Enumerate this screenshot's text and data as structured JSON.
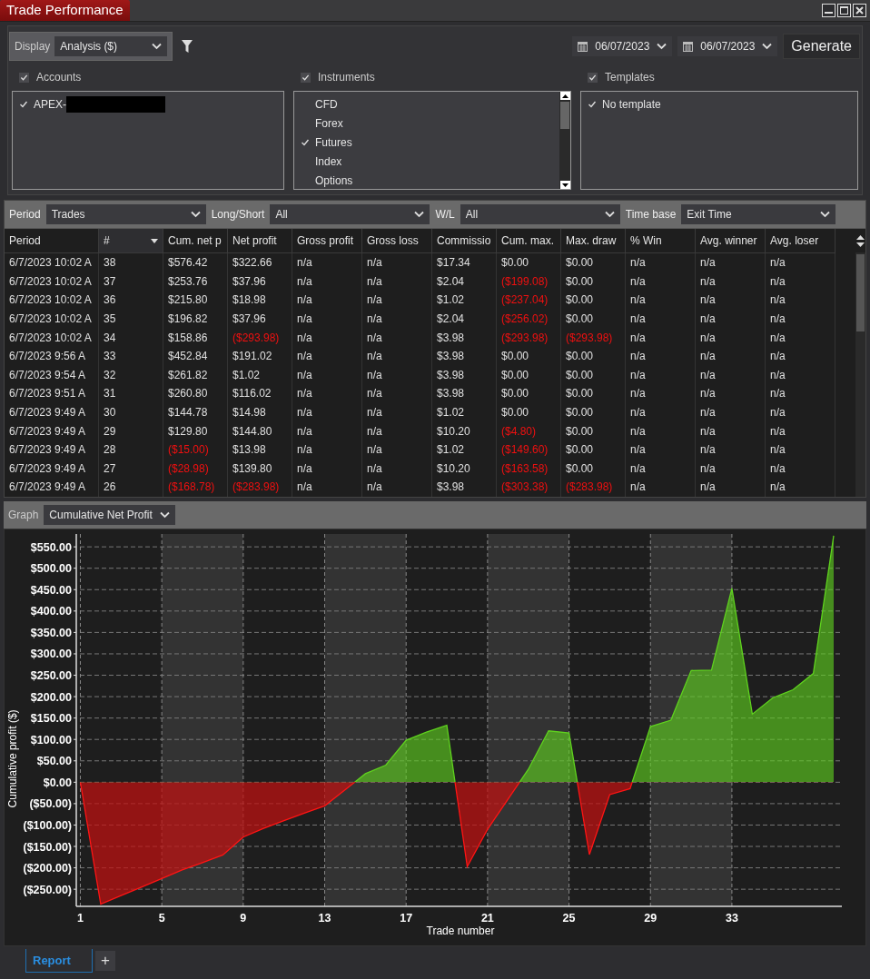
{
  "window": {
    "title": "Trade Performance"
  },
  "toolbar": {
    "display_label": "Display",
    "display_value": "Analysis ($)",
    "from_date": "06/07/2023",
    "to_date": "06/07/2023",
    "generate": "Generate"
  },
  "filters": [
    {
      "label": "Accounts",
      "checked": true,
      "kind": "plain",
      "items": [
        {
          "label": "APEX-",
          "checked": true,
          "redacted": true
        }
      ]
    },
    {
      "label": "Instruments",
      "checked": true,
      "kind": "scroll",
      "items": [
        {
          "label": "CFD",
          "checked": false,
          "redacted": false
        },
        {
          "label": "Forex",
          "checked": false,
          "redacted": false
        },
        {
          "label": "Futures",
          "checked": true,
          "redacted": false
        },
        {
          "label": "Index",
          "checked": false,
          "redacted": false
        },
        {
          "label": "Options",
          "checked": false,
          "redacted": false
        }
      ]
    },
    {
      "label": "Templates",
      "checked": true,
      "kind": "plain",
      "items": [
        {
          "label": "No template",
          "checked": true,
          "redacted": false
        }
      ]
    }
  ],
  "report": {
    "filters": [
      {
        "label": "Period",
        "value": "Trades"
      },
      {
        "label": "Long/Short",
        "value": "All"
      },
      {
        "label": "W/L",
        "value": "All"
      },
      {
        "label": "Time base",
        "value": "Exit Time"
      }
    ],
    "columns": [
      {
        "label": "Period",
        "sorted": false
      },
      {
        "label": "#",
        "sorted": true
      },
      {
        "label": "Cum. net p",
        "sorted": false
      },
      {
        "label": "Net profit",
        "sorted": false
      },
      {
        "label": "Gross profit",
        "sorted": false
      },
      {
        "label": "Gross loss",
        "sorted": false
      },
      {
        "label": "Commissio",
        "sorted": false
      },
      {
        "label": "Cum. max.",
        "sorted": false
      },
      {
        "label": "Max. draw",
        "sorted": false
      },
      {
        "label": "% Win",
        "sorted": false
      },
      {
        "label": "Avg. winner",
        "sorted": false
      },
      {
        "label": "Avg. loser",
        "sorted": false
      }
    ],
    "rows": [
      [
        "6/7/2023 10:02 A",
        "38",
        "$576.42",
        "$322.66",
        "n/a",
        "n/a",
        "$17.34",
        "$0.00",
        "$0.00",
        "n/a",
        "n/a",
        "n/a"
      ],
      [
        "6/7/2023 10:02 A",
        "37",
        "$253.76",
        "$37.96",
        "n/a",
        "n/a",
        "$2.04",
        {
          "text": "($199.08)",
          "negative": true
        },
        "$0.00",
        "n/a",
        "n/a",
        "n/a"
      ],
      [
        "6/7/2023 10:02 A",
        "36",
        "$215.80",
        "$18.98",
        "n/a",
        "n/a",
        "$1.02",
        {
          "text": "($237.04)",
          "negative": true
        },
        "$0.00",
        "n/a",
        "n/a",
        "n/a"
      ],
      [
        "6/7/2023 10:02 A",
        "35",
        "$196.82",
        "$37.96",
        "n/a",
        "n/a",
        "$2.04",
        {
          "text": "($256.02)",
          "negative": true
        },
        "$0.00",
        "n/a",
        "n/a",
        "n/a"
      ],
      [
        "6/7/2023 10:02 A",
        "34",
        "$158.86",
        {
          "text": "($293.98)",
          "negative": true
        },
        "n/a",
        "n/a",
        "$3.98",
        {
          "text": "($293.98)",
          "negative": true
        },
        {
          "text": "($293.98)",
          "negative": true
        },
        "n/a",
        "n/a",
        "n/a"
      ],
      [
        "6/7/2023 9:56 A",
        "33",
        "$452.84",
        "$191.02",
        "n/a",
        "n/a",
        "$3.98",
        "$0.00",
        "$0.00",
        "n/a",
        "n/a",
        "n/a"
      ],
      [
        "6/7/2023 9:54 A",
        "32",
        "$261.82",
        "$1.02",
        "n/a",
        "n/a",
        "$3.98",
        "$0.00",
        "$0.00",
        "n/a",
        "n/a",
        "n/a"
      ],
      [
        "6/7/2023 9:51 A",
        "31",
        "$260.80",
        "$116.02",
        "n/a",
        "n/a",
        "$3.98",
        "$0.00",
        "$0.00",
        "n/a",
        "n/a",
        "n/a"
      ],
      [
        "6/7/2023 9:49 A",
        "30",
        "$144.78",
        "$14.98",
        "n/a",
        "n/a",
        "$1.02",
        "$0.00",
        "$0.00",
        "n/a",
        "n/a",
        "n/a"
      ],
      [
        "6/7/2023 9:49 A",
        "29",
        "$129.80",
        "$144.80",
        "n/a",
        "n/a",
        "$10.20",
        {
          "text": "($4.80)",
          "negative": true
        },
        "$0.00",
        "n/a",
        "n/a",
        "n/a"
      ],
      [
        "6/7/2023 9:49 A",
        "28",
        {
          "text": "($15.00)",
          "negative": true
        },
        "$13.98",
        "n/a",
        "n/a",
        "$1.02",
        {
          "text": "($149.60)",
          "negative": true
        },
        "$0.00",
        "n/a",
        "n/a",
        "n/a"
      ],
      [
        "6/7/2023 9:49 A",
        "27",
        {
          "text": "($28.98)",
          "negative": true
        },
        "$139.80",
        "n/a",
        "n/a",
        "$10.20",
        {
          "text": "($163.58)",
          "negative": true
        },
        "$0.00",
        "n/a",
        "n/a",
        "n/a"
      ],
      [
        "6/7/2023 9:49 A",
        "26",
        {
          "text": "($168.78)",
          "negative": true
        },
        {
          "text": "($283.98)",
          "negative": true
        },
        "n/a",
        "n/a",
        "$3.98",
        {
          "text": "($303.38)",
          "negative": true
        },
        {
          "text": "($283.98)",
          "negative": true
        },
        "n/a",
        "n/a",
        "n/a"
      ]
    ]
  },
  "graph": {
    "label": "Graph",
    "value": "Cumulative Net Profit",
    "chart_data": {
      "type": "area",
      "xlabel": "Trade number",
      "ylabel": "Cumulative profit ($)",
      "x": [
        1,
        2,
        3,
        4,
        5,
        6,
        7,
        8,
        9,
        10,
        11,
        12,
        13,
        14,
        15,
        16,
        17,
        18,
        19,
        20,
        21,
        22,
        23,
        24,
        25,
        26,
        27,
        28,
        29,
        30,
        31,
        32,
        33,
        34,
        35,
        36,
        37,
        38
      ],
      "series": [
        {
          "color": "#5fd21e",
          "values": [
            0,
            -285,
            -265,
            -245,
            -225,
            -205,
            -188,
            -170,
            -128,
            -108,
            -90,
            -72,
            -55,
            -18,
            20,
            40,
            98,
            117,
            133,
            -197,
            -110,
            -40,
            30,
            120,
            115,
            -169,
            -29,
            -15,
            130,
            145,
            261,
            262,
            453,
            159,
            197,
            216,
            254,
            576
          ]
        }
      ],
      "grid": true,
      "xlim": [
        0.8,
        38.4
      ],
      "ylim": [
        -290,
        580
      ],
      "xticks": [
        1,
        5,
        9,
        13,
        17,
        21,
        25,
        29,
        33
      ],
      "yticks": [
        {
          "value": 550,
          "label": "$550.00"
        },
        {
          "value": 500,
          "label": "$500.00"
        },
        {
          "value": 450,
          "label": "$450.00"
        },
        {
          "value": 400,
          "label": "$400.00"
        },
        {
          "value": 350,
          "label": "$350.00"
        },
        {
          "value": 300,
          "label": "$300.00"
        },
        {
          "value": 250,
          "label": "$250.00"
        },
        {
          "value": 200,
          "label": "$200.00"
        },
        {
          "value": 150,
          "label": "$150.00"
        },
        {
          "value": 100,
          "label": "$100.00"
        },
        {
          "value": 50,
          "label": "$50.00"
        },
        {
          "value": 0,
          "label": "$0.00"
        },
        {
          "value": -50,
          "label": "($50.00)"
        },
        {
          "value": -100,
          "label": "($100.00)"
        },
        {
          "value": -150,
          "label": "($150.00)"
        },
        {
          "value": -200,
          "label": "($200.00)"
        },
        {
          "value": -250,
          "label": "($250.00)"
        }
      ]
    }
  },
  "tabs": [
    {
      "label": "Report",
      "selected": true
    }
  ],
  "add_tab": "+"
}
